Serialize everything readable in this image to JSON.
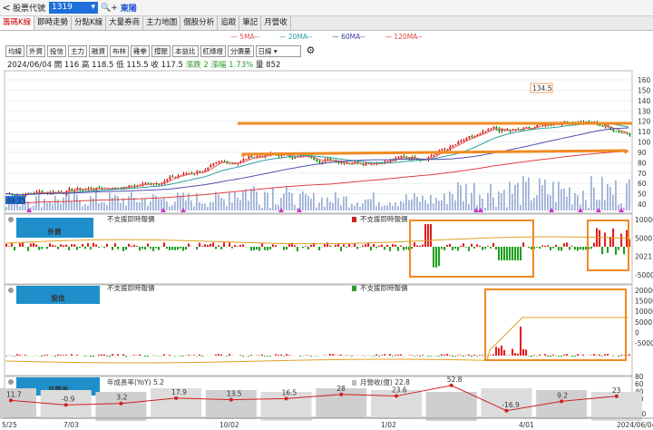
{
  "topbar": {
    "back": "<",
    "label": "股票代號",
    "code": "1319",
    "search_icon": "🔍+",
    "name": "東陽"
  },
  "tabs": [
    "籌碼K線",
    "即時走勢",
    "分點K線",
    "大量券商",
    "主力地圖",
    "個股分析",
    "追蹤",
    "筆記",
    "月營收"
  ],
  "legend": [
    {
      "label": "5MA--",
      "color": "#e05050"
    },
    {
      "label": "20MA--",
      "color": "#2aa0a0"
    },
    {
      "label": "60MA--",
      "color": "#4040a0"
    },
    {
      "label": "120MA--",
      "color": "#e04040"
    }
  ],
  "tools": [
    "均線",
    "外資",
    "投信",
    "主力",
    "融資",
    "布林",
    "雞拳",
    "撐壓",
    "本益比",
    "紅綠燈",
    "分價量"
  ],
  "period": "日線",
  "ohlc": {
    "date": "2024/06/04",
    "open_label": "開",
    "open": "116",
    "high_label": "高",
    "high": "118.5",
    "low_label": "低",
    "low": "115.5",
    "close_label": "收",
    "close": "117.5",
    "chg_label": "漲跌",
    "chg": "2",
    "pct_label": "漲幅",
    "pct": "1.73%",
    "vol_label": "量",
    "vol": "852"
  },
  "price_axis": [
    "160",
    "150",
    "140",
    "130",
    "120",
    "110",
    "100",
    "90",
    "80",
    "70",
    "60",
    "50",
    "40"
  ],
  "peak_label": "134.5",
  "low_label": "49.35",
  "foreign": {
    "title": "外資",
    "note1": "不支援即時報價",
    "note2": "不支援即時報價",
    "axis": [
      "10000",
      "5000",
      "2021",
      "-5000"
    ]
  },
  "trust": {
    "title": "投信",
    "note1": "不支援即時報價",
    "note2": "不支援即時報價",
    "axis": [
      "20000",
      "15000",
      "10000",
      "5000",
      "0",
      "-5000"
    ]
  },
  "revenue": {
    "title": "月營收",
    "yoy_label": "年成長率(YoY)",
    "yoy": "5.2",
    "rev_label": "月營收(億)",
    "rev": "22.8",
    "axis": [
      "80",
      "60",
      "40",
      "20",
      "0",
      "-20"
    ],
    "points": [
      "11.7",
      "-0.9",
      "3.2",
      "17.9",
      "13.5",
      "16.5",
      "28",
      "23.6",
      "52.8",
      "-16.9",
      "9.2",
      "23"
    ]
  },
  "dates": [
    "5/25",
    "7/03",
    "10/02",
    "1/02",
    "4/01",
    "2024/06/04"
  ]
}
